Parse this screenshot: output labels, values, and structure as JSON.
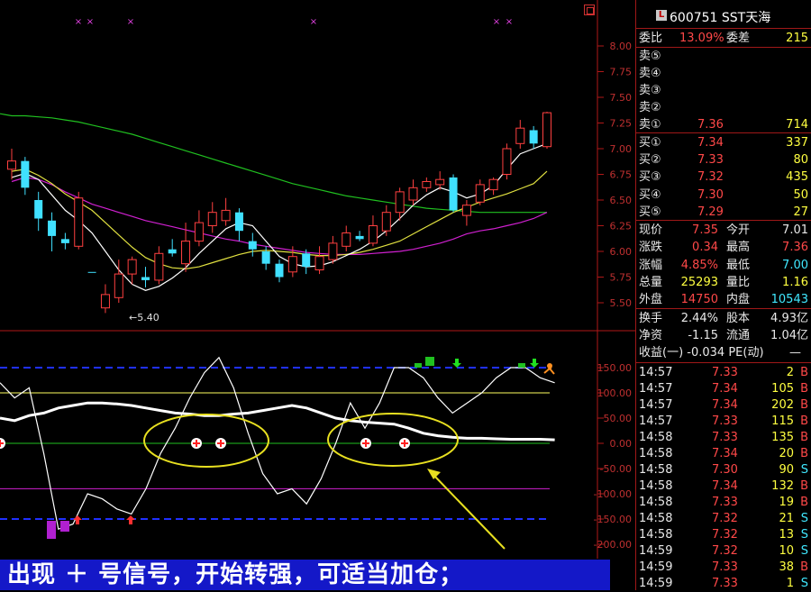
{
  "stock": {
    "code_name": "600751 SST天海",
    "logo": "L"
  },
  "chart": {
    "price_ticks": [
      "8.00",
      "7.75",
      "7.50",
      "7.25",
      "7.00",
      "6.75",
      "6.50",
      "6.25",
      "6.00",
      "5.75",
      "5.50"
    ],
    "low_marker": "←5.40",
    "indicator_ticks": [
      "150.00",
      "100.00",
      "50.00",
      "0.00",
      "-50.00",
      "-100.00",
      "-150.00",
      "-200.00"
    ]
  },
  "chart_data": {
    "type": "candlestick",
    "ylim": [
      5.45,
      8.12
    ],
    "candles": [
      {
        "o": 6.8,
        "c": 6.88,
        "h": 7.0,
        "l": 6.7,
        "up": true
      },
      {
        "o": 6.88,
        "c": 6.62,
        "h": 6.92,
        "l": 6.55,
        "up": false
      },
      {
        "o": 6.5,
        "c": 6.32,
        "h": 6.58,
        "l": 6.2,
        "up": false
      },
      {
        "o": 6.3,
        "c": 6.15,
        "h": 6.38,
        "l": 6.0,
        "up": false
      },
      {
        "o": 6.12,
        "c": 6.08,
        "h": 6.18,
        "l": 6.02,
        "up": false
      },
      {
        "o": 6.05,
        "c": 6.52,
        "h": 6.58,
        "l": 6.02,
        "up": true
      },
      {
        "o": 5.8,
        "c": 5.8,
        "h": 5.8,
        "l": 5.8,
        "up": false
      },
      {
        "o": 5.45,
        "c": 5.58,
        "h": 5.68,
        "l": 5.4,
        "up": true
      },
      {
        "o": 5.55,
        "c": 5.78,
        "h": 5.92,
        "l": 5.5,
        "up": true
      },
      {
        "o": 5.78,
        "c": 5.92,
        "h": 5.95,
        "l": 5.68,
        "up": true
      },
      {
        "o": 5.75,
        "c": 5.72,
        "h": 5.85,
        "l": 5.65,
        "up": false
      },
      {
        "o": 5.72,
        "c": 5.98,
        "h": 6.05,
        "l": 5.68,
        "up": true
      },
      {
        "o": 5.98,
        "c": 6.02,
        "h": 6.12,
        "l": 5.95,
        "up": false
      },
      {
        "o": 5.88,
        "c": 6.1,
        "h": 6.28,
        "l": 5.8,
        "up": true
      },
      {
        "o": 6.1,
        "c": 6.28,
        "h": 6.4,
        "l": 6.05,
        "up": true
      },
      {
        "o": 6.25,
        "c": 6.38,
        "h": 6.48,
        "l": 6.18,
        "up": true
      },
      {
        "o": 6.3,
        "c": 6.4,
        "h": 6.52,
        "l": 6.25,
        "up": true
      },
      {
        "o": 6.38,
        "c": 6.2,
        "h": 6.42,
        "l": 6.1,
        "up": false
      },
      {
        "o": 6.1,
        "c": 6.02,
        "h": 6.18,
        "l": 5.95,
        "up": false
      },
      {
        "o": 6.0,
        "c": 5.88,
        "h": 6.05,
        "l": 5.82,
        "up": false
      },
      {
        "o": 5.88,
        "c": 5.75,
        "h": 5.92,
        "l": 5.7,
        "up": false
      },
      {
        "o": 5.8,
        "c": 5.95,
        "h": 6.05,
        "l": 5.75,
        "up": true
      },
      {
        "o": 5.98,
        "c": 5.85,
        "h": 6.02,
        "l": 5.78,
        "up": false
      },
      {
        "o": 5.82,
        "c": 5.95,
        "h": 6.05,
        "l": 5.78,
        "up": true
      },
      {
        "o": 5.92,
        "c": 6.08,
        "h": 6.15,
        "l": 5.88,
        "up": true
      },
      {
        "o": 6.05,
        "c": 6.18,
        "h": 6.25,
        "l": 6.0,
        "up": true
      },
      {
        "o": 6.15,
        "c": 6.12,
        "h": 6.2,
        "l": 6.1,
        "up": false
      },
      {
        "o": 6.08,
        "c": 6.25,
        "h": 6.35,
        "l": 6.05,
        "up": true
      },
      {
        "o": 6.2,
        "c": 6.38,
        "h": 6.45,
        "l": 6.15,
        "up": true
      },
      {
        "o": 6.38,
        "c": 6.58,
        "h": 6.62,
        "l": 6.3,
        "up": true
      },
      {
        "o": 6.5,
        "c": 6.62,
        "h": 6.7,
        "l": 6.45,
        "up": true
      },
      {
        "o": 6.62,
        "c": 6.68,
        "h": 6.72,
        "l": 6.58,
        "up": true
      },
      {
        "o": 6.65,
        "c": 6.7,
        "h": 6.78,
        "l": 6.6,
        "up": true
      },
      {
        "o": 6.72,
        "c": 6.4,
        "h": 6.75,
        "l": 6.38,
        "up": false
      },
      {
        "o": 6.35,
        "c": 6.45,
        "h": 6.5,
        "l": 6.25,
        "up": true
      },
      {
        "o": 6.48,
        "c": 6.65,
        "h": 6.7,
        "l": 6.45,
        "up": true
      },
      {
        "o": 6.6,
        "c": 6.7,
        "h": 6.72,
        "l": 6.55,
        "up": true
      },
      {
        "o": 6.75,
        "c": 7.0,
        "h": 7.05,
        "l": 6.7,
        "up": true
      },
      {
        "o": 7.05,
        "c": 7.2,
        "h": 7.28,
        "l": 7.0,
        "up": true
      },
      {
        "o": 7.18,
        "c": 7.05,
        "h": 7.22,
        "l": 7.0,
        "up": false
      },
      {
        "o": 7.02,
        "c": 7.35,
        "h": 7.36,
        "l": 7.0,
        "up": true
      }
    ],
    "ma_long": [
      7.32,
      7.32,
      7.31,
      7.3,
      7.28,
      7.26,
      7.23,
      7.2,
      7.17,
      7.14,
      7.1,
      7.06,
      7.02,
      6.98,
      6.94,
      6.9,
      6.86,
      6.82,
      6.78,
      6.74,
      6.7,
      6.66,
      6.63,
      6.6,
      6.57,
      6.54,
      6.52,
      6.5,
      6.48,
      6.46,
      6.44,
      6.42,
      6.41,
      6.4,
      6.39,
      6.38,
      6.38,
      6.38,
      6.38,
      6.38,
      6.38
    ],
    "ma_mid": [
      6.68,
      6.72,
      6.7,
      6.65,
      6.58,
      6.52,
      6.46,
      6.42,
      6.38,
      6.34,
      6.3,
      6.27,
      6.24,
      6.21,
      6.18,
      6.15,
      6.12,
      6.1,
      6.07,
      6.05,
      6.03,
      6.01,
      5.99,
      5.98,
      5.97,
      5.97,
      5.97,
      5.98,
      5.99,
      6.0,
      6.02,
      6.05,
      6.08,
      6.12,
      6.17,
      6.2,
      6.22,
      6.25,
      6.28,
      6.32,
      6.38
    ],
    "ma_yellow": [
      6.78,
      6.8,
      6.74,
      6.66,
      6.56,
      6.48,
      6.4,
      6.28,
      6.16,
      6.04,
      5.94,
      5.88,
      5.84,
      5.83,
      5.85,
      5.89,
      5.93,
      5.97,
      6.0,
      6.01,
      6.0,
      5.99,
      5.97,
      5.96,
      5.96,
      5.97,
      5.99,
      6.02,
      6.06,
      6.1,
      6.17,
      6.24,
      6.31,
      6.38,
      6.43,
      6.48,
      6.52,
      6.56,
      6.61,
      6.66,
      6.78
    ],
    "ma_white": [
      6.72,
      6.76,
      6.7,
      6.55,
      6.4,
      6.3,
      6.18,
      6.0,
      5.82,
      5.68,
      5.62,
      5.66,
      5.74,
      5.84,
      5.98,
      6.1,
      6.22,
      6.28,
      6.25,
      6.1,
      5.95,
      5.88,
      5.85,
      5.86,
      5.9,
      5.96,
      6.02,
      6.1,
      6.2,
      6.32,
      6.45,
      6.55,
      6.62,
      6.58,
      6.52,
      6.56,
      6.64,
      6.8,
      6.95,
      7.0,
      7.05
    ],
    "signal_marks_x": [
      0,
      2,
      6,
      27,
      39,
      41
    ],
    "indicator": {
      "ylim": [
        -210,
        165
      ],
      "ref_lines": [
        150,
        100,
        0,
        -90,
        -150
      ],
      "cci": [
        120,
        90,
        110,
        -20,
        -170,
        -160,
        -100,
        -110,
        -130,
        -140,
        -90,
        -20,
        30,
        90,
        140,
        170,
        110,
        20,
        -60,
        -100,
        -90,
        -120,
        -70,
        0,
        80,
        30,
        80,
        150,
        150,
        130,
        90,
        60,
        80,
        100,
        130,
        150,
        150,
        130,
        120
      ],
      "smooth": [
        50,
        45,
        55,
        60,
        70,
        75,
        80,
        80,
        78,
        75,
        70,
        65,
        60,
        58,
        55,
        55,
        58,
        60,
        65,
        70,
        75,
        70,
        60,
        50,
        45,
        42,
        40,
        38,
        30,
        20,
        15,
        12,
        10,
        10,
        9,
        8,
        8,
        8,
        7
      ]
    }
  },
  "annotation": "出现 ＋ 号信号，开始转强，可适当加仓；",
  "quote": {
    "weibi_label": "委比",
    "weibi": "13.09%",
    "weicha_label": "委差",
    "weicha": "215",
    "asks": [
      {
        "label": "卖⑤",
        "price": "",
        "vol": ""
      },
      {
        "label": "卖④",
        "price": "",
        "vol": ""
      },
      {
        "label": "卖③",
        "price": "",
        "vol": ""
      },
      {
        "label": "卖②",
        "price": "",
        "vol": ""
      },
      {
        "label": "卖①",
        "price": "7.36",
        "vol": "714"
      }
    ],
    "bids": [
      {
        "label": "买①",
        "price": "7.34",
        "vol": "337"
      },
      {
        "label": "买②",
        "price": "7.33",
        "vol": "80"
      },
      {
        "label": "买③",
        "price": "7.32",
        "vol": "435"
      },
      {
        "label": "买④",
        "price": "7.30",
        "vol": "50"
      },
      {
        "label": "买⑤",
        "price": "7.29",
        "vol": "27"
      }
    ],
    "stats": [
      {
        "l1": "现价",
        "v1": "7.35",
        "c1": "red",
        "l2": "今开",
        "v2": "7.01",
        "c2": "white"
      },
      {
        "l1": "涨跌",
        "v1": "0.34",
        "c1": "red",
        "l2": "最高",
        "v2": "7.36",
        "c2": "red"
      },
      {
        "l1": "涨幅",
        "v1": "4.85%",
        "c1": "red",
        "l2": "最低",
        "v2": "7.00",
        "c2": "cyan"
      },
      {
        "l1": "总量",
        "v1": "25293",
        "c1": "yellow",
        "l2": "量比",
        "v2": "1.16",
        "c2": "yellow"
      },
      {
        "l1": "外盘",
        "v1": "14750",
        "c1": "red",
        "l2": "内盘",
        "v2": "10543",
        "c2": "cyan"
      }
    ],
    "extra": [
      {
        "l1": "换手",
        "v1": "2.44%",
        "l2": "股本",
        "v2": "4.93亿"
      },
      {
        "l1": "净资",
        "v1": "-1.15",
        "l2": "流通",
        "v2": "1.04亿"
      }
    ],
    "shouyi": "收益(一) -0.034 PE(动)",
    "shouyi_pe": "—"
  },
  "ticks": [
    {
      "t": "14:57",
      "p": "7.33",
      "v": "2",
      "s": "B"
    },
    {
      "t": "14:57",
      "p": "7.34",
      "v": "105",
      "s": "B"
    },
    {
      "t": "14:57",
      "p": "7.34",
      "v": "202",
      "s": "B"
    },
    {
      "t": "14:57",
      "p": "7.33",
      "v": "115",
      "s": "B"
    },
    {
      "t": "14:58",
      "p": "7.33",
      "v": "135",
      "s": "B"
    },
    {
      "t": "14:58",
      "p": "7.34",
      "v": "20",
      "s": "B"
    },
    {
      "t": "14:58",
      "p": "7.30",
      "v": "90",
      "s": "S"
    },
    {
      "t": "14:58",
      "p": "7.34",
      "v": "132",
      "s": "B"
    },
    {
      "t": "14:58",
      "p": "7.33",
      "v": "19",
      "s": "B"
    },
    {
      "t": "14:58",
      "p": "7.32",
      "v": "21",
      "s": "S"
    },
    {
      "t": "14:58",
      "p": "7.32",
      "v": "13",
      "s": "S"
    },
    {
      "t": "14:59",
      "p": "7.32",
      "v": "10",
      "s": "S"
    },
    {
      "t": "14:59",
      "p": "7.33",
      "v": "38",
      "s": "B"
    },
    {
      "t": "14:59",
      "p": "7.33",
      "v": "1",
      "s": "S"
    }
  ]
}
